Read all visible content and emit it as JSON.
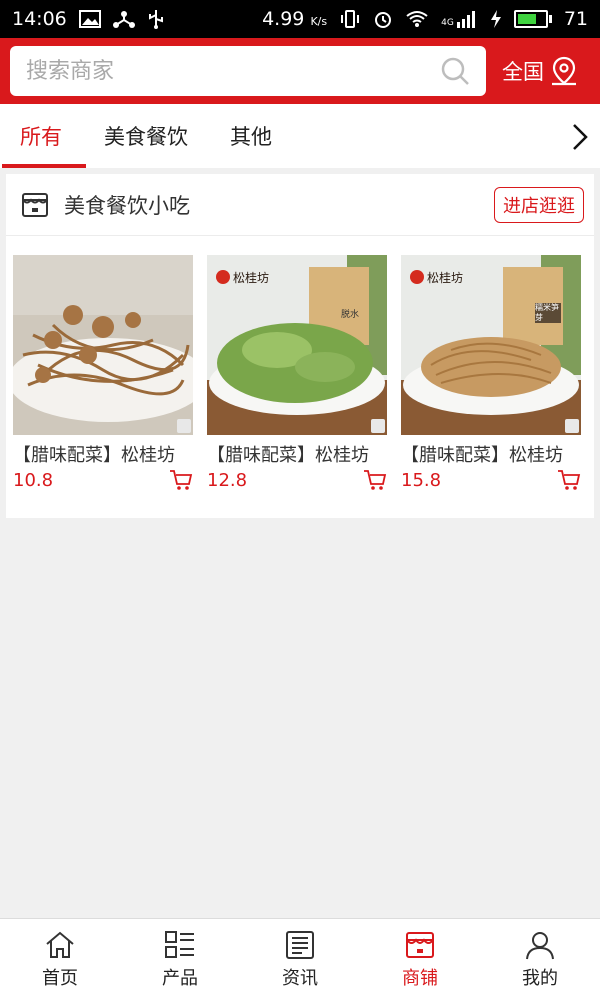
{
  "status_bar": {
    "time": "14:06",
    "speed": "4.99",
    "speed_unit": "K/s",
    "network": "4G",
    "battery": "71",
    "battery_level": 0.71
  },
  "header": {
    "search_placeholder": "搜索商家",
    "region": "全国"
  },
  "tabs": [
    {
      "label": "所有",
      "active": true
    },
    {
      "label": "美食餐饮",
      "active": false
    },
    {
      "label": "其他",
      "active": false
    }
  ],
  "shop": {
    "name": "美食餐饮小吃",
    "visit_label": "进店逛逛",
    "products": [
      {
        "title": "【腊味配菜】松桂坊",
        "price": "10.8",
        "brand": "",
        "pack": ""
      },
      {
        "title": "【腊味配菜】松桂坊",
        "price": "12.8",
        "brand": "松桂坊",
        "pack": "脱水"
      },
      {
        "title": "【腊味配菜】松桂坊",
        "price": "15.8",
        "brand": "松桂坊",
        "pack": "糯米笋芽"
      }
    ]
  },
  "bottom_nav": [
    {
      "label": "首页",
      "icon": "home-icon",
      "active": false
    },
    {
      "label": "产品",
      "icon": "grid-list-icon",
      "active": false
    },
    {
      "label": "资讯",
      "icon": "news-icon",
      "active": false
    },
    {
      "label": "商铺",
      "icon": "store-icon",
      "active": true
    },
    {
      "label": "我的",
      "icon": "user-icon",
      "active": false
    }
  ],
  "colors": {
    "brand_red": "#d9191c",
    "price_red": "#d9191c",
    "page_bg": "#f0f0f0"
  }
}
